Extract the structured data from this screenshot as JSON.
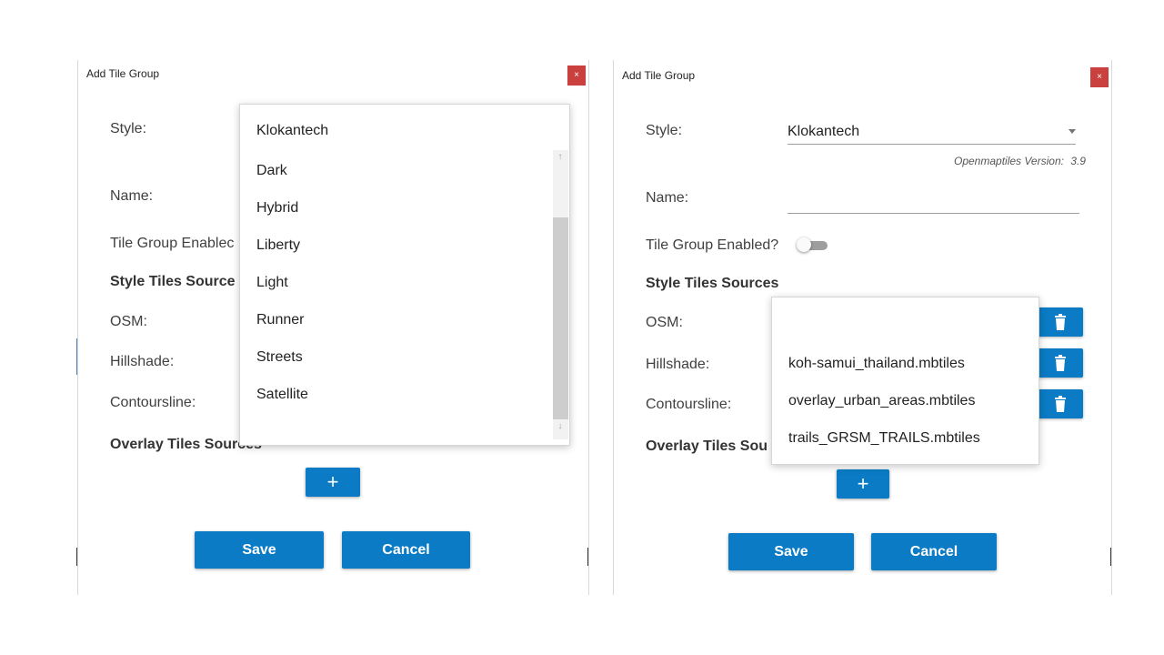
{
  "left": {
    "title": "Add Tile Group",
    "close": "×",
    "style_label": "Style:",
    "name_label": "Name:",
    "enabled_label": "Tile Group Enablec",
    "style_sources_heading": "Style Tiles Source",
    "osm_label": "OSM:",
    "hillshade_label": "Hillshade:",
    "contours_label": "Contoursline:",
    "overlay_heading": "Overlay Tiles Sources",
    "add_label": "+",
    "save_label": "Save",
    "cancel_label": "Cancel",
    "style_options": [
      "Klokantech",
      "Dark",
      "Hybrid",
      "Liberty",
      "Light",
      "Runner",
      "Streets",
      "Satellite"
    ],
    "scroll_up": "↑",
    "scroll_down": "↓"
  },
  "right": {
    "title": "Add Tile Group",
    "close": "×",
    "style_label": "Style:",
    "style_value": "Klokantech",
    "version_label": "Openmaptiles Version:",
    "version_value": "3.9",
    "name_label": "Name:",
    "name_value": "",
    "enabled_label": "Tile Group Enabled?",
    "enabled_state": "off",
    "style_sources_heading": "Style Tiles Sources",
    "osm_label": "OSM:",
    "hillshade_label": "Hillshade:",
    "contours_label": "Contoursline:",
    "overlay_heading": "Overlay Tiles Sou",
    "add_label": "+",
    "save_label": "Save",
    "cancel_label": "Cancel",
    "file_options": [
      "",
      "koh-samui_thailand.mbtiles",
      "overlay_urban_areas.mbtiles",
      "trails_GRSM_TRAILS.mbtiles"
    ]
  },
  "colors": {
    "primary_button": "#0a7bc4",
    "close_button": "#c9403f"
  },
  "icons": {
    "delete": "trash-icon",
    "dropdown": "caret-down-icon",
    "close": "close-icon"
  }
}
